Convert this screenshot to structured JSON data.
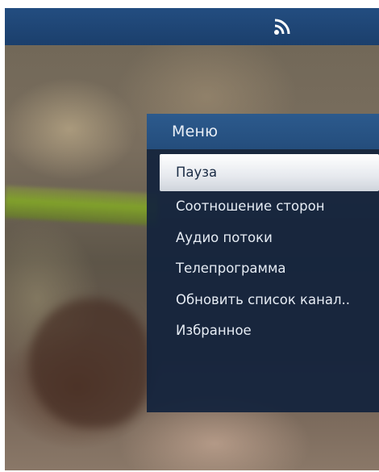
{
  "menu": {
    "title": "Меню",
    "items": [
      {
        "label": "Пауза",
        "selected": true
      },
      {
        "label": "Соотношение сторон",
        "selected": false
      },
      {
        "label": "Аудио потоки",
        "selected": false
      },
      {
        "label": "Телепрограмма",
        "selected": false
      },
      {
        "label": "Обновить список канал..",
        "selected": false
      },
      {
        "label": "Избранное",
        "selected": false
      }
    ]
  },
  "top_bar": {
    "icon": "rss-broadcast-icon"
  },
  "colors": {
    "top_bar": "#1f4676",
    "menu_header": "#285486",
    "menu_panel": "#12223c",
    "selected_item": "#eef0f4"
  }
}
